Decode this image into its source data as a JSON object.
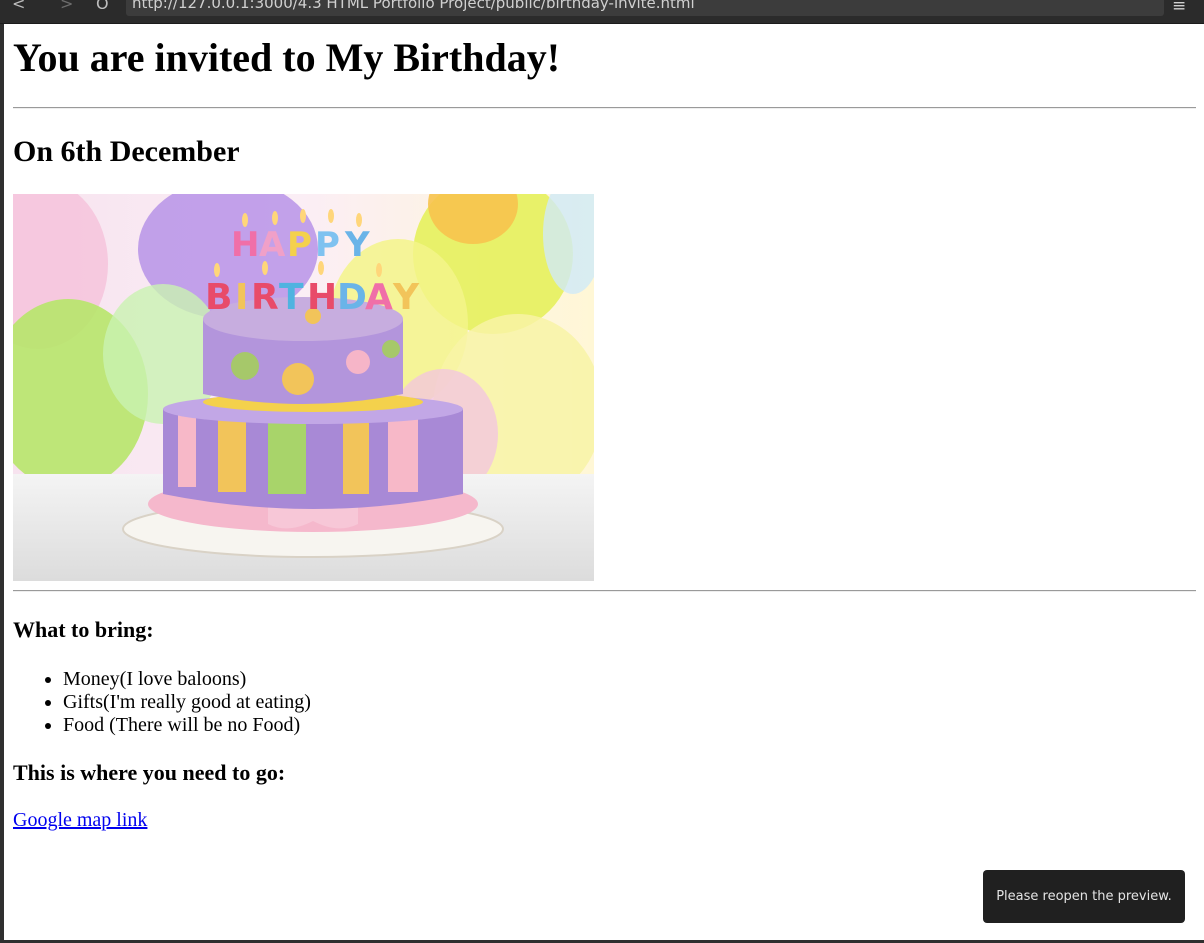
{
  "browser": {
    "url": "http://127.0.0.1:3000/4.3 HTML Portfolio Project/public/birthday-invite.html",
    "back_icon": "<",
    "forward_icon": ">",
    "reload_icon": "O",
    "menu_icon": "≡"
  },
  "page": {
    "heading": "You are invited to My Birthday!",
    "date_heading": "On 6th December",
    "bring_heading": "What to bring:",
    "bring_items": [
      "Money(I love baloons)",
      "Gifts(I'm really good at eating)",
      "Food (There will be no Food)"
    ],
    "location_heading": "This is where you need to go:",
    "map_link": "Google map link"
  },
  "toast": {
    "message": "Please reopen the preview."
  },
  "colors": {
    "link": "#0000ee",
    "toast_bg": "#202020"
  }
}
